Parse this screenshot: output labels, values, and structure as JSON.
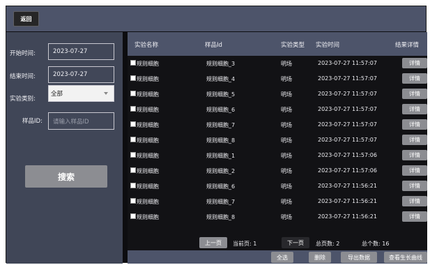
{
  "header": {
    "back_label": "返回"
  },
  "filters": {
    "start_time_label": "开始时间:",
    "start_time_value": "2023-07-27",
    "end_time_label": "结束时间:",
    "end_time_value": "2023-07-27",
    "type_label": "实验类别:",
    "type_value": "全部",
    "sample_id_label": "样品ID:",
    "sample_id_placeholder": "请输入样品ID",
    "search_label": "搜索"
  },
  "table": {
    "columns": [
      "实验名称",
      "样品Id",
      "实验类型",
      "实验时间",
      "结果详情"
    ],
    "rows": [
      {
        "name": "规则细胞",
        "sample": "规则细胞_3",
        "type": "明场",
        "time": "2023-07-27 11:57:07",
        "action": "详情"
      },
      {
        "name": "规则细胞",
        "sample": "规则细胞_4",
        "type": "明场",
        "time": "2023-07-27 11:57:07",
        "action": "详情"
      },
      {
        "name": "规则细胞",
        "sample": "规则细胞_5",
        "type": "明场",
        "time": "2023-07-27 11:57:07",
        "action": "详情"
      },
      {
        "name": "规则细胞",
        "sample": "规则细胞_6",
        "type": "明场",
        "time": "2023-07-27 11:57:07",
        "action": "详情"
      },
      {
        "name": "规则细胞",
        "sample": "规则细胞_7",
        "type": "明场",
        "time": "2023-07-27 11:57:07",
        "action": "详情"
      },
      {
        "name": "规则细胞",
        "sample": "规则细胞_8",
        "type": "明场",
        "time": "2023-07-27 11:57:07",
        "action": "详情"
      },
      {
        "name": "规则细胞",
        "sample": "规则细胞_1",
        "type": "明场",
        "time": "2023-07-27 11:57:06",
        "action": "详情"
      },
      {
        "name": "规则细胞",
        "sample": "规则细胞_2",
        "type": "明场",
        "time": "2023-07-27 11:57:06",
        "action": "详情"
      },
      {
        "name": "规则细胞",
        "sample": "规则细胞_6",
        "type": "明场",
        "time": "2023-07-27 11:56:21",
        "action": "详情"
      },
      {
        "name": "规则细胞",
        "sample": "规则细胞_7",
        "type": "明场",
        "time": "2023-07-27 11:56:21",
        "action": "详情"
      },
      {
        "name": "规则细胞",
        "sample": "规则细胞_8",
        "type": "明场",
        "time": "2023-07-27 11:56:21",
        "action": "详情"
      }
    ]
  },
  "pager": {
    "prev_label": "上一页",
    "current_page_text": "当前页: 1",
    "next_label": "下一页",
    "total_pages_text": "总页数: 2",
    "total_count_text": "总个数: 16"
  },
  "actions": {
    "select_all": "全选",
    "delete": "删除",
    "export": "导出数据",
    "growth_curve": "查看生长曲线"
  },
  "colors": {
    "panel": "#404657",
    "header_bar": "#4d546a",
    "table_bg": "#121215",
    "button_gray": "#8c8d92",
    "prev_button": "#8c8d92",
    "next_button": "#28282c"
  }
}
